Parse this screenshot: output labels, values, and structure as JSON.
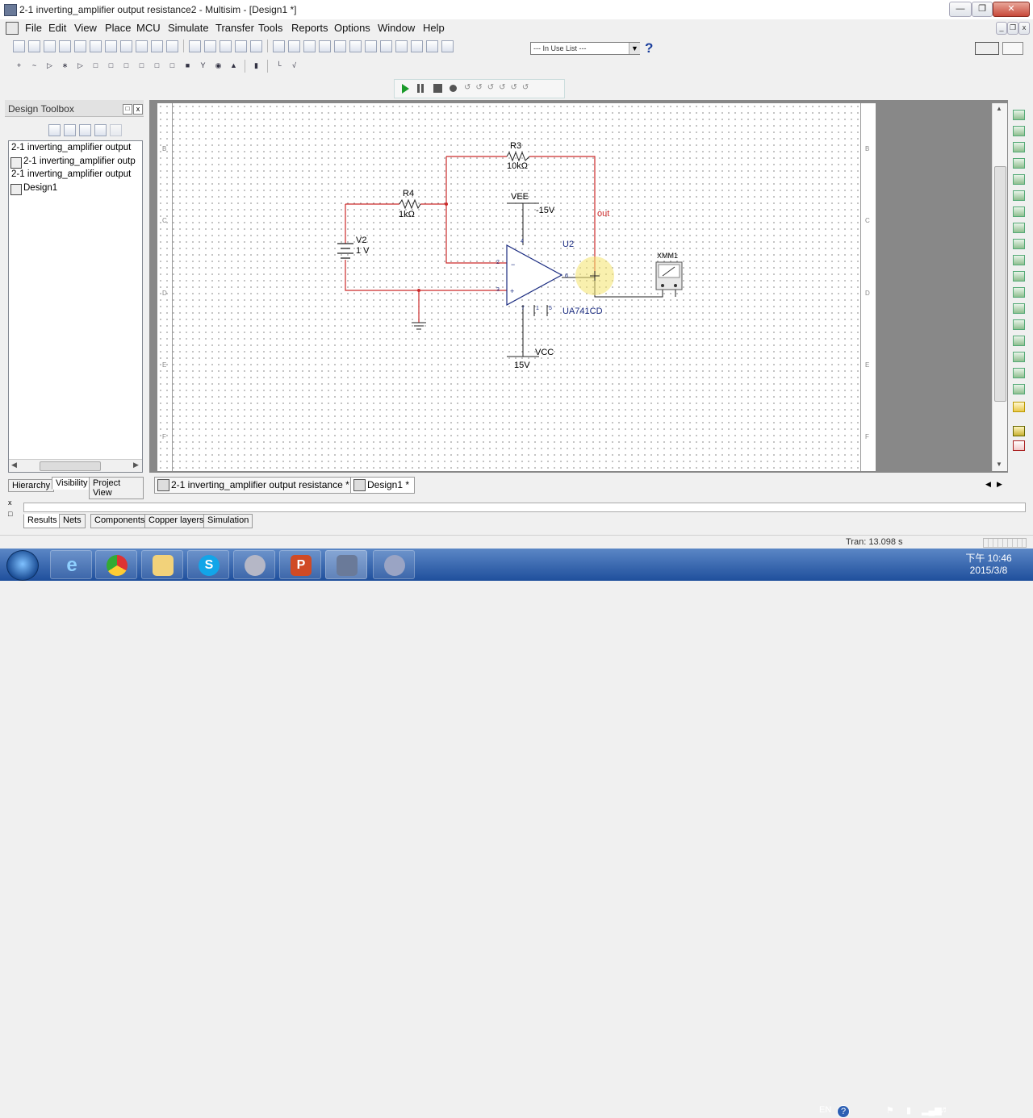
{
  "window": {
    "title": "2-1 inverting_amplifier output resistance2 - Multisim - [Design1 *]"
  },
  "menu": [
    "File",
    "Edit",
    "View",
    "Place",
    "MCU",
    "Simulate",
    "Transfer",
    "Tools",
    "Reports",
    "Options",
    "Window",
    "Help"
  ],
  "toolbar": {
    "in_use_list": "--- In Use List ---",
    "help": "?"
  },
  "toolbox": {
    "title": "Design Toolbox",
    "items": [
      "2-1 inverting_amplifier output",
      "2-1 inverting_amplifier outp",
      "2-1 inverting_amplifier output",
      "Design1"
    ],
    "tabs": [
      "Hierarchy",
      "Visibility",
      "Project View"
    ]
  },
  "schematic": {
    "r3": {
      "name": "R3",
      "value": "10kΩ"
    },
    "r4": {
      "name": "R4",
      "value": "1kΩ"
    },
    "v2": {
      "name": "V2",
      "value": "1 V"
    },
    "vee": {
      "name": "VEE",
      "value": "-15V"
    },
    "vcc": {
      "name": "VCC",
      "value": "15V"
    },
    "u2": {
      "name": "U2",
      "part": "UA741CD"
    },
    "net_out": "out",
    "xmm1": "XMM1",
    "pins": {
      "p2": "2",
      "p3": "3",
      "p4": "4",
      "p6": "6",
      "p7": "7",
      "p1": "1",
      "p5": "5"
    },
    "frame_rows": [
      "B",
      "C",
      "D",
      "E",
      "F"
    ]
  },
  "doc_tabs": [
    "2-1 inverting_amplifier output resistance *",
    "Design1 *"
  ],
  "spreadsheet_tabs": [
    "Results",
    "Nets",
    "Components",
    "Copper layers",
    "Simulation"
  ],
  "status": {
    "tran": "Tran: 13.098 s"
  },
  "taskbar": {
    "lang": "EN",
    "time": "下午 10:46",
    "date": "2015/3/8"
  }
}
